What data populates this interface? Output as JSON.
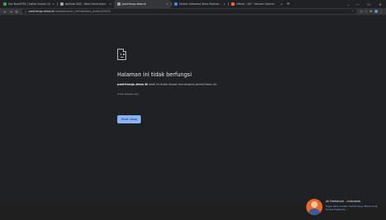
{
  "tabs": [
    {
      "title": "Opr NewSTKS | Daftar Usulan Ch",
      "favicon_color": "#34a853",
      "active": false
    },
    {
      "title": "Aplikasi SIKS - Next Generation",
      "favicon_color": "#9aa0a6",
      "active": false
    },
    {
      "title": "pasirlangu.desa.id",
      "favicon_color": "#9aa0a6",
      "active": true
    },
    {
      "title": "Sistem Informasi Desa Pasirlangu",
      "favicon_color": "#4285f4",
      "active": false
    },
    {
      "title": "cPanel - Git™ Version Control",
      "favicon_color": "#ff6c2c",
      "active": false
    }
  ],
  "tab_close": "×",
  "new_tab": "+",
  "tab_search_icon": "⌄",
  "window_controls": {
    "minimize": "—",
    "maximize": "☐",
    "close": "✕"
  },
  "nav": {
    "back": "←",
    "forward": "→",
    "reload": "↻"
  },
  "omnibox": {
    "info_icon": "ⓘ",
    "host": "pasirlangu.desa.id",
    "path": "/umkdokumen_kembalikan_status/22445",
    "star": "☆"
  },
  "extensions": {
    "ext1": "⬡",
    "ext2": "✧",
    "puzzle": "⧉",
    "menu": "⋮"
  },
  "error": {
    "title": "Halaman ini tidak berfungsi",
    "host_bold": "pasirlangu.desa.id",
    "desc_rest": " saat ini tidak dapat menangani permintaan ini.",
    "code": "HTTP ERROR 500",
    "reload_button": "Muat ulang"
  },
  "toast": {
    "header": "ak Freelancer - Indonesia",
    "message": "Tugas lebih mudah, hemat biaya. Bisnis anda terima freelancer ..."
  }
}
